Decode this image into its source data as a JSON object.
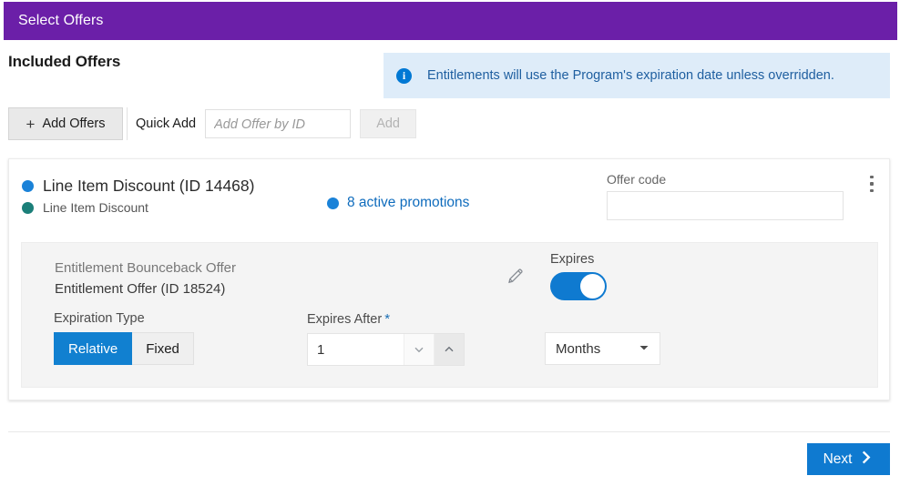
{
  "titlebar": {
    "title": "Select Offers",
    "background": "#6b1fa8"
  },
  "heading": {
    "page_title": "Included Offers"
  },
  "info_banner": {
    "icon": "info-icon",
    "message": "Entitlements will use the Program's expiration date unless overridden.",
    "background": "#deecf9",
    "text_color": "#1f5fa0"
  },
  "toolbar": {
    "add_offers_label": "Add Offers",
    "add_offers_icon": "plus-icon",
    "quick_add_label": "Quick Add",
    "quick_add_placeholder": "Add Offer by ID",
    "quick_add_value": "",
    "add_button_label": "Add",
    "add_button_enabled": false
  },
  "offer_card": {
    "title": "Line Item Discount (ID 14468)",
    "subtitle": "Line Item Discount",
    "title_dot_color": "#1a82d8",
    "subtitle_dot_color": "#1b7f79",
    "promotions_text": "8 active promotions",
    "promotions_dot_color": "#1a82d8",
    "offer_code_label": "Offer code",
    "offer_code_value": "",
    "menu_icon": "kebab-menu-icon"
  },
  "entitlement": {
    "name": "Entitlement Bounceback Offer",
    "id_text": "Entitlement Offer (ID 18524)",
    "edit_icon": "pencil-icon",
    "expires_label": "Expires",
    "expires_toggle_on": true,
    "expiration_type_label": "Expiration Type",
    "segment_relative": "Relative",
    "segment_fixed": "Fixed",
    "segment_selected": "Relative",
    "expires_after_label": "Expires After",
    "required_marker": "*",
    "expires_after_value": "1",
    "spin_down_icon": "chevron-down-icon",
    "spin_up_icon": "chevron-up-icon",
    "unit_value": "Months",
    "unit_caret_icon": "chevron-down-icon"
  },
  "footer": {
    "next_label": "Next",
    "next_icon": "chevron-right-icon",
    "next_color": "#0f7ad0"
  }
}
